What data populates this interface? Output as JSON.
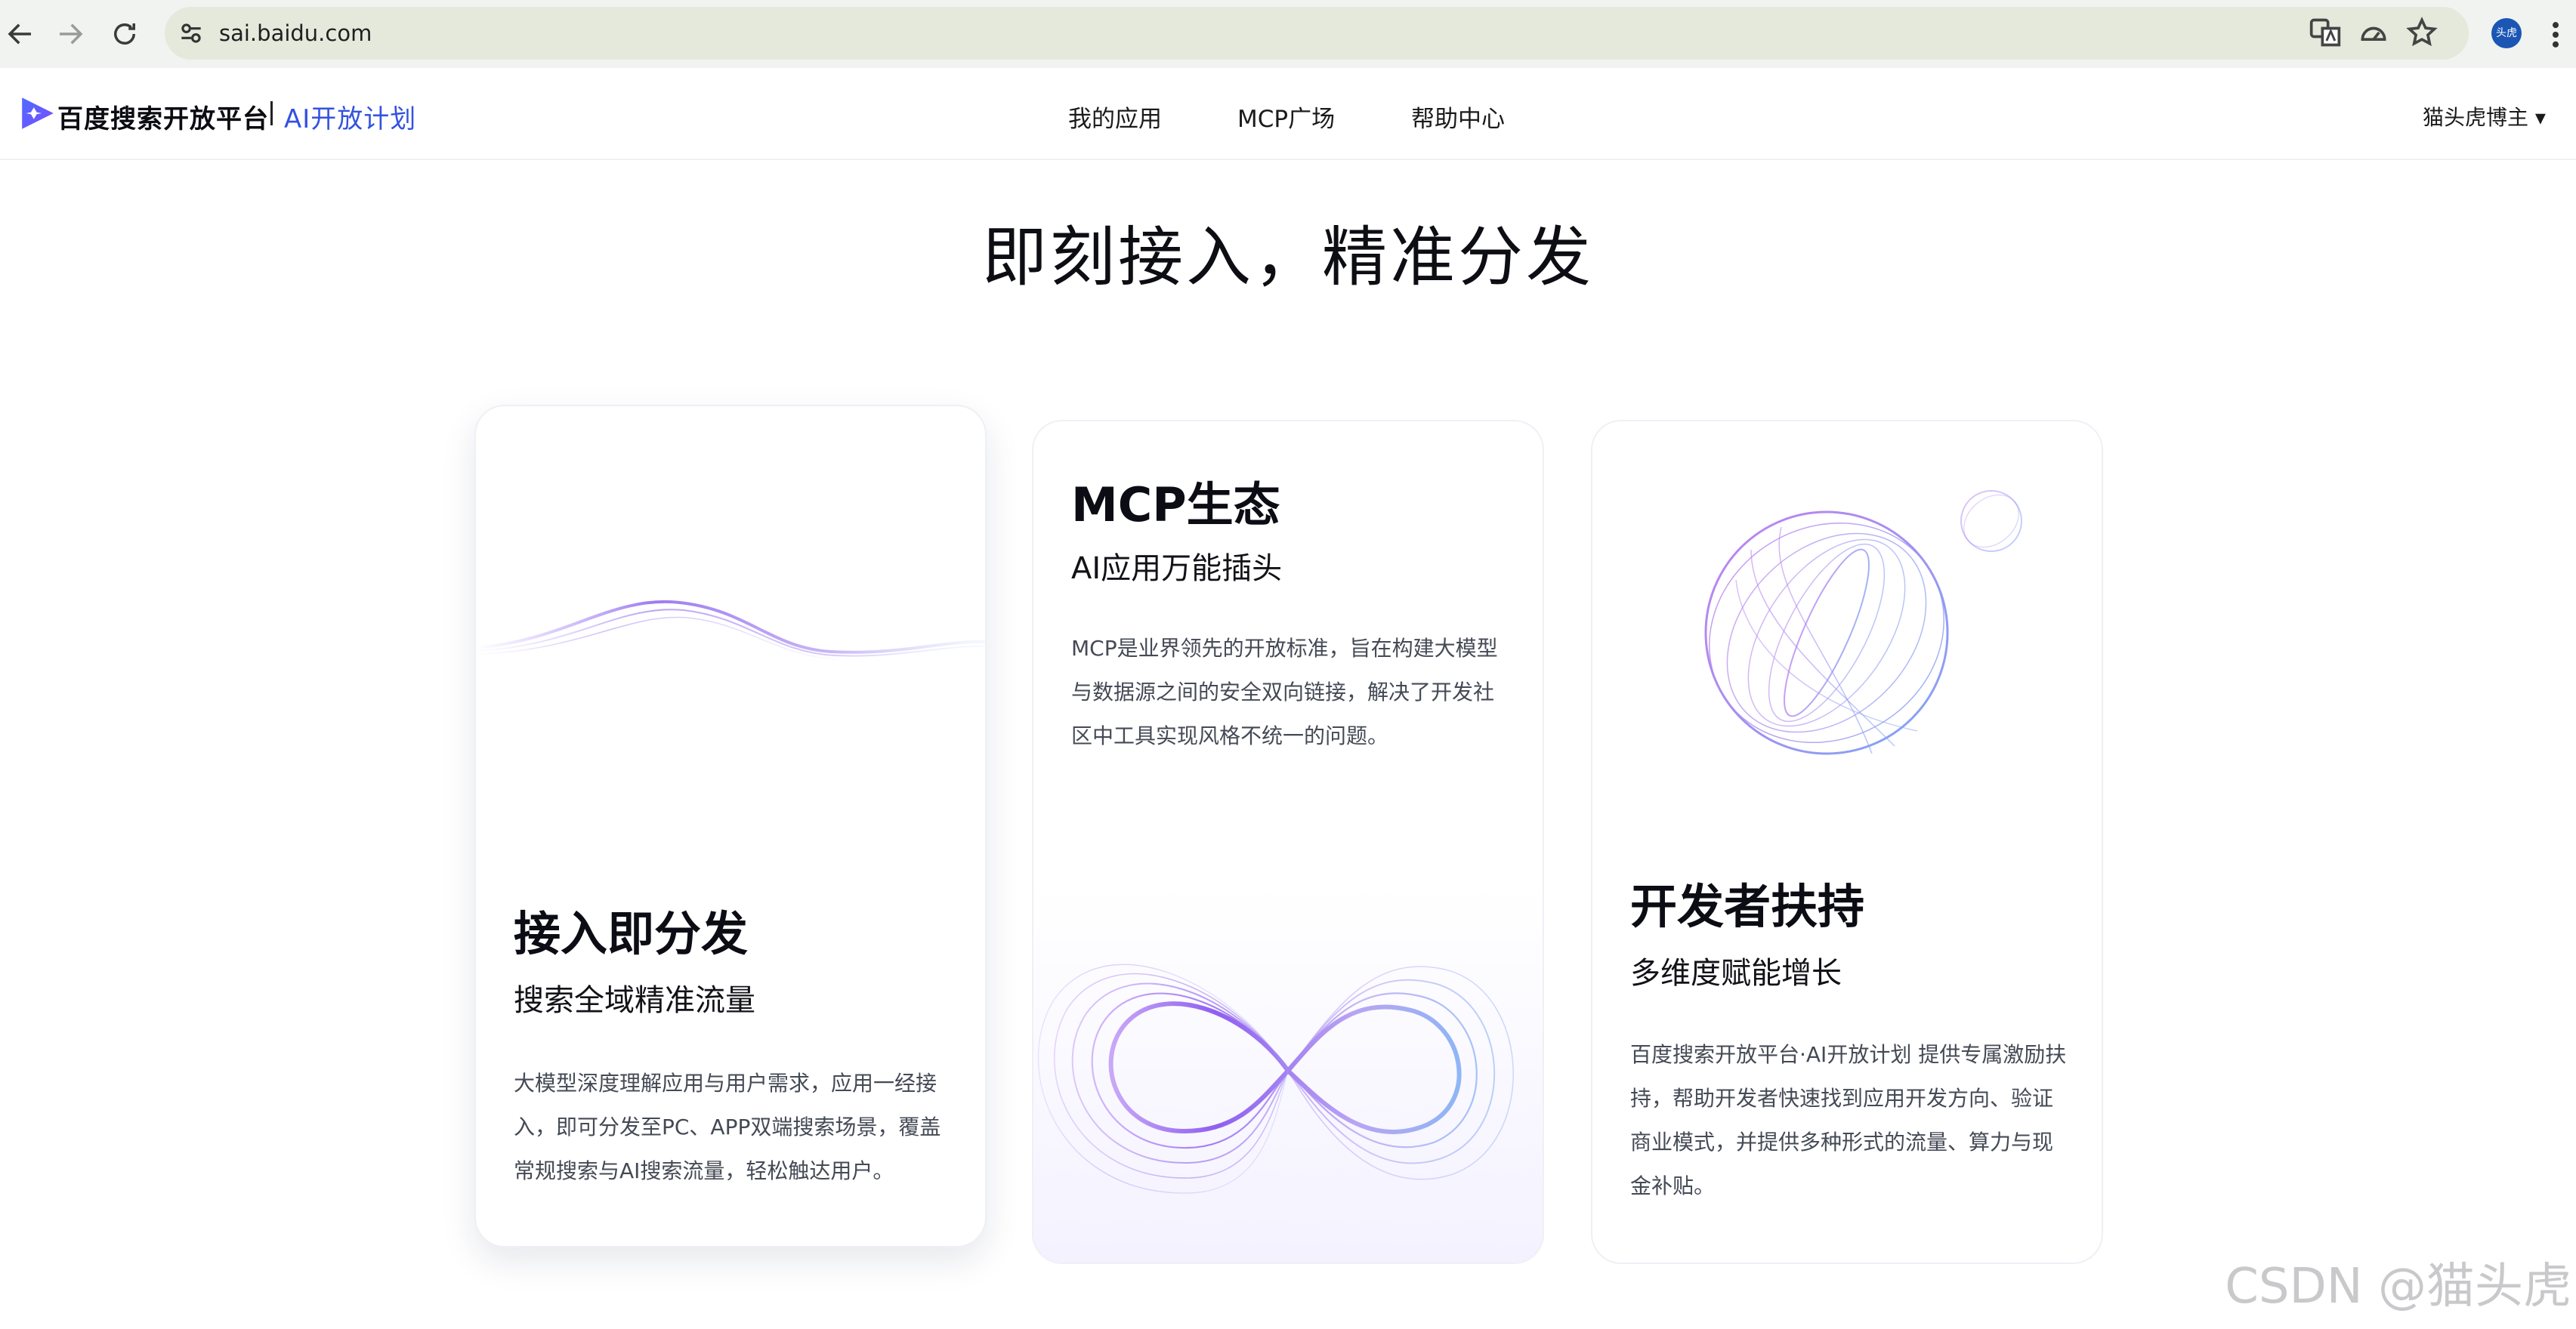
{
  "browser": {
    "url": "sai.baidu.com",
    "profile_initials": "头虎"
  },
  "header": {
    "logo_text": "百度搜索开放平台",
    "logo_sub": "AI开放计划",
    "nav": [
      "我的应用",
      "MCP广场",
      "帮助中心"
    ],
    "user_name": "猫头虎博主 ▾"
  },
  "hero": {
    "title": "即刻接入，精准分发"
  },
  "cards": [
    {
      "title": "接入即分发",
      "subtitle": "搜索全域精准流量",
      "desc": "大模型深度理解应用与用户需求，应用一经接入，即可分发至PC、APP双端搜索场景，覆盖常规搜索与AI搜索流量，轻松触达用户。"
    },
    {
      "title": "MCP生态",
      "subtitle": "AI应用万能插头",
      "desc": "MCP是业界领先的开放标准，旨在构建大模型与数据源之间的安全双向链接，解决了开发社区中工具实现风格不统一的问题。"
    },
    {
      "title": "开发者扶持",
      "subtitle": "多维度赋能增长",
      "desc": "百度搜索开放平台·AI开放计划 提供专属激励扶持，帮助开发者快速找到应用开发方向、验证商业模式，并提供多种形式的流量、算力与现金补贴。"
    }
  ],
  "watermark": "CSDN @猫头虎",
  "colors": {
    "brand_blue": "#3452e0",
    "accent_purple": "#a57bf0",
    "accent_light_blue": "#8fb6f5"
  }
}
